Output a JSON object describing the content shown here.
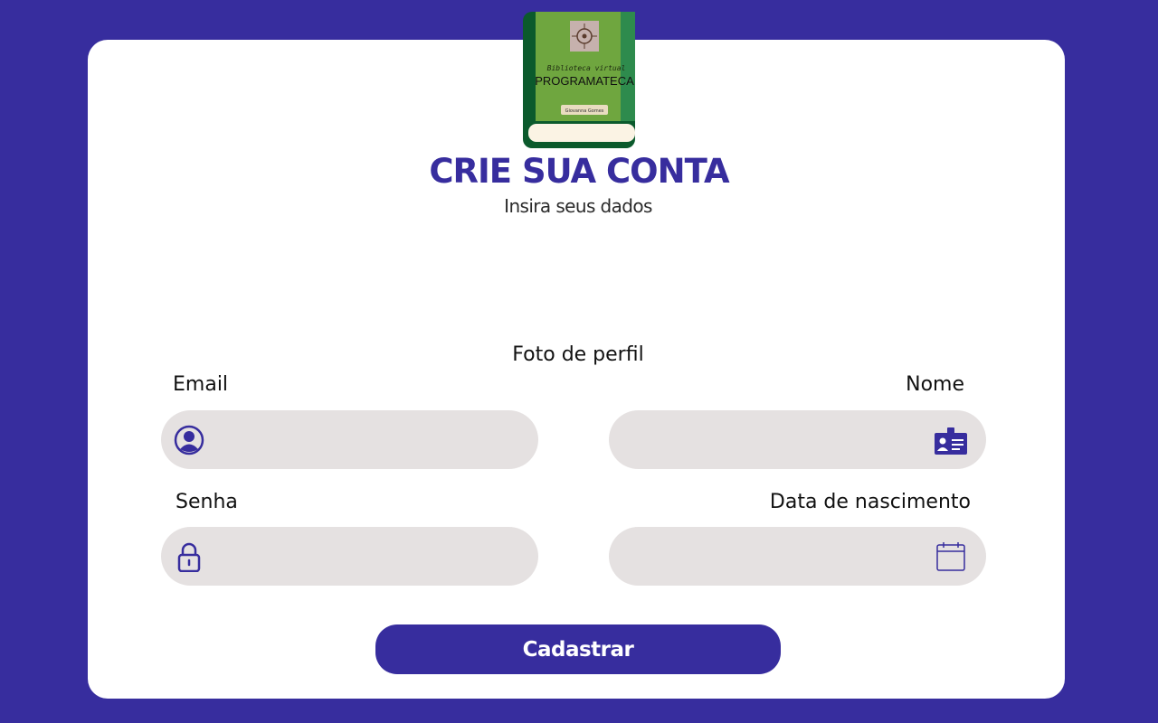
{
  "header": {
    "logo_title": "Biblioteca virtual",
    "logo_name": "PROGRAMATECA",
    "logo_author": "Giovanna Gomes",
    "title": "CRIE SUA CONTA",
    "subtitle": "Insira seus dados"
  },
  "form": {
    "photo_label": "Foto de perfil",
    "email": {
      "label": "Email",
      "value": "",
      "icon": "user-circle-icon"
    },
    "nome": {
      "label": "Nome",
      "value": "",
      "icon": "id-card-icon"
    },
    "senha": {
      "label": "Senha",
      "value": "",
      "icon": "lock-icon"
    },
    "data_nascimento": {
      "label": "Data de nascimento",
      "value": "",
      "icon": "calendar-icon"
    },
    "submit_label": "Cadastrar"
  },
  "colors": {
    "background": "#372d9e",
    "card": "#ffffff",
    "input": "#e5e1e1",
    "accent": "#372d9e"
  }
}
